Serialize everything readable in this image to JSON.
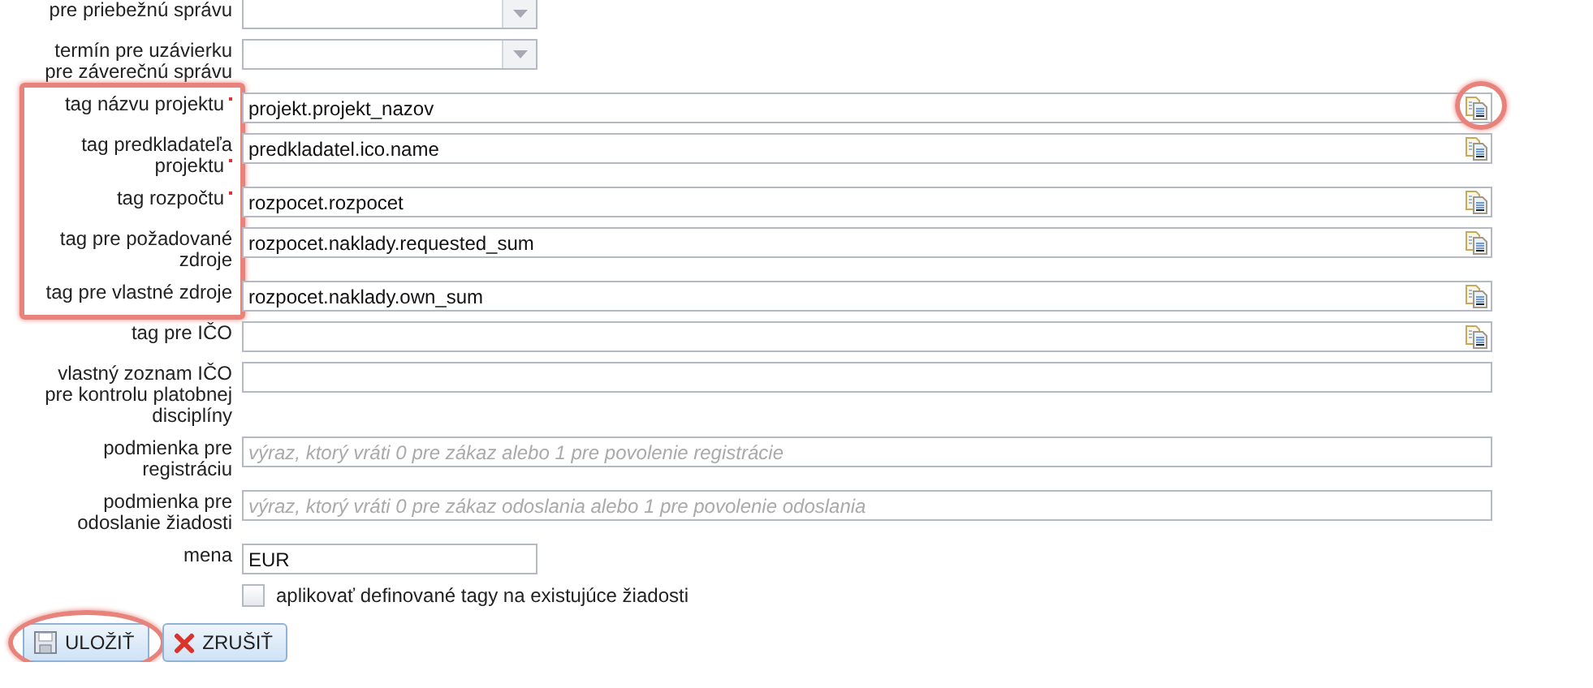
{
  "groups": [
    {
      "highlighted": false,
      "rows": [
        {
          "label": "pre priebežnú správu",
          "required": false,
          "kind": "select",
          "value": ""
        },
        {
          "label": "termín pre uzávierku pre záverečnú správu",
          "required": false,
          "kind": "select",
          "value": ""
        }
      ]
    },
    {
      "highlighted": true,
      "rows": [
        {
          "label": "tag názvu projektu",
          "required": true,
          "kind": "tag",
          "value": "projekt.projekt_nazov",
          "icon_highlighted": true
        },
        {
          "label": "tag predkladateľa projektu",
          "required": true,
          "kind": "tag",
          "value": "predkladatel.ico.name",
          "icon_highlighted": false
        },
        {
          "label": "tag rozpočtu",
          "required": true,
          "kind": "tag",
          "value": "rozpocet.rozpocet",
          "icon_highlighted": false
        },
        {
          "label": "tag pre požadované zdroje",
          "required": false,
          "kind": "tag",
          "value": "rozpocet.naklady.requested_sum",
          "icon_highlighted": false
        },
        {
          "label": "tag pre vlastné zdroje",
          "required": false,
          "kind": "tag",
          "value": "rozpocet.naklady.own_sum",
          "icon_highlighted": false
        }
      ]
    },
    {
      "highlighted": false,
      "rows": [
        {
          "label": "tag pre IČO",
          "required": false,
          "kind": "tag",
          "value": "",
          "icon_highlighted": false
        },
        {
          "label": "vlastný zoznam IČO pre kontrolu platobnej disciplíny",
          "required": false,
          "kind": "text",
          "value": ""
        },
        {
          "label": "podmienka pre registráciu",
          "required": false,
          "kind": "text",
          "placeholder": "výraz, ktorý vráti 0 pre zákaz alebo 1 pre povolenie registrácie"
        },
        {
          "label": "podmienka pre odoslanie žiadosti",
          "required": false,
          "kind": "text",
          "placeholder": "výraz, ktorý vráti 0 pre zákaz odoslania alebo 1 pre povolenie odoslania"
        },
        {
          "label": "mena",
          "required": false,
          "kind": "short",
          "value": "EUR"
        },
        {
          "label": "aplikovať definované tagy na existujúce žiadosti",
          "required": false,
          "kind": "checkbox",
          "checked": false
        }
      ]
    }
  ],
  "buttons": [
    {
      "label": "ULOŽIŤ",
      "kind": "save",
      "highlighted": true
    },
    {
      "label": "ZRUŠIŤ",
      "kind": "cancel",
      "highlighted": false
    }
  ]
}
